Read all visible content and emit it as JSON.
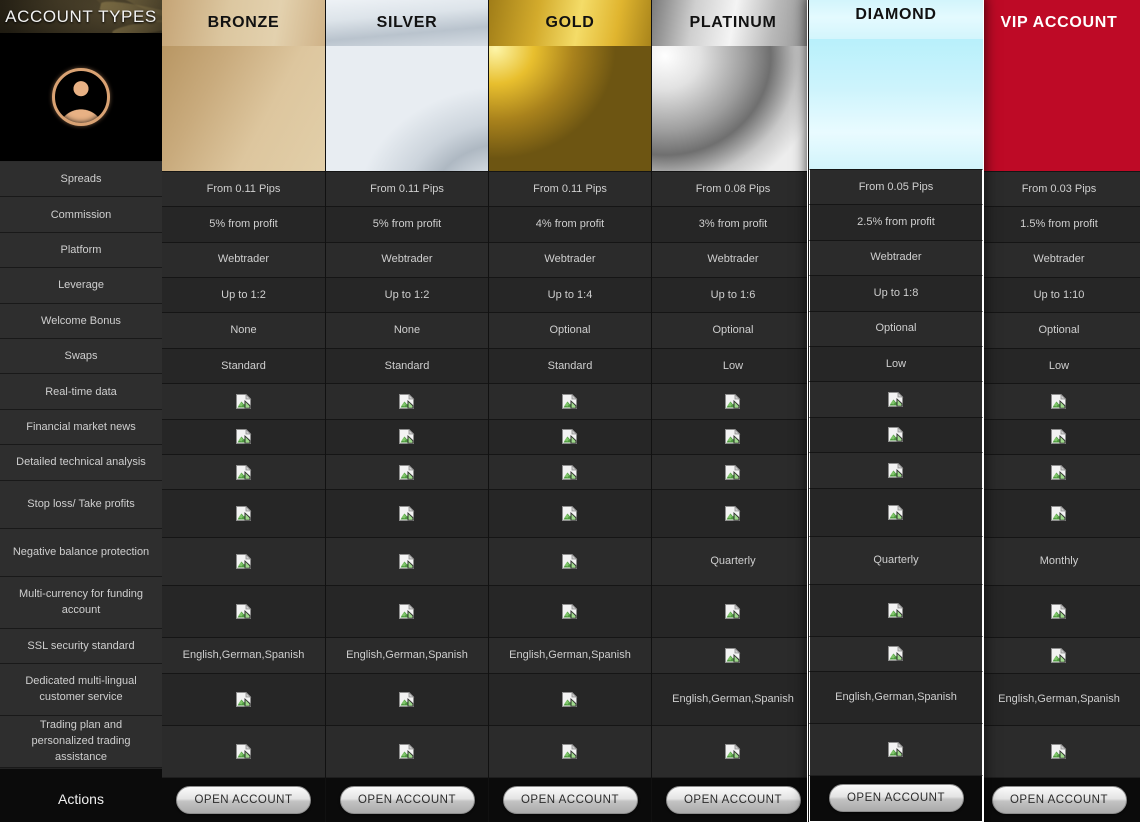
{
  "sidebar": {
    "title": "ACCOUNT TYPES",
    "avatar_icon": "user-avatar-icon",
    "features": [
      {
        "label": "Spreads",
        "size": "one"
      },
      {
        "label": "Commission",
        "size": "one"
      },
      {
        "label": "Platform",
        "size": "one"
      },
      {
        "label": "Leverage",
        "size": "one"
      },
      {
        "label": "Welcome Bonus",
        "size": "one"
      },
      {
        "label": "Swaps",
        "size": "one"
      },
      {
        "label": "Real-time data",
        "size": "one"
      },
      {
        "label": "Financial market news",
        "size": "one"
      },
      {
        "label": "Detailed technical analysis",
        "size": "one"
      },
      {
        "label": "Stop loss/ Take profits",
        "size": "tall"
      },
      {
        "label": "Negative balance protection",
        "size": "tall"
      },
      {
        "label": "Multi-currency for funding account",
        "size": "two"
      },
      {
        "label": "SSL security standard",
        "size": "one"
      },
      {
        "label": "Dedicated multi-lingual customer service",
        "size": "two"
      },
      {
        "label": "Trading plan and personalized trading assistance",
        "size": "two"
      }
    ],
    "actions_label": "Actions"
  },
  "colors": {
    "vip_accent": "#be0a26",
    "diamond_accent": "#cdf4fc",
    "gold_accent": "#e8bf2e",
    "bronze_accent": "#c9ab7d",
    "silver_accent": "#d4dbe2",
    "platinum_accent": "#cfcfcf",
    "cell_background": "#2b2b2b",
    "panel_background": "#000000"
  },
  "cta_label": "OPEN ACCOUNT",
  "broken_image_icon": "broken-image-icon",
  "columns": [
    {
      "name": "BRONZE",
      "head_class": "hd-bronze",
      "swatch_class": "sw-bronze",
      "light_text": false,
      "featured": false,
      "values": [
        "From 0.11 Pips",
        "5% from profit",
        "Webtrader",
        "Up to 1:2",
        "None",
        "Standard",
        "",
        "",
        "",
        "",
        "",
        "",
        "English,German,Spanish",
        ""
      ]
    },
    {
      "name": "SILVER",
      "head_class": "hd-silver",
      "swatch_class": "sw-silver",
      "light_text": false,
      "featured": false,
      "values": [
        "From 0.11 Pips",
        "5% from profit",
        "Webtrader",
        "Up to 1:2",
        "None",
        "Standard",
        "",
        "",
        "",
        "",
        "",
        "",
        "English,German,Spanish",
        ""
      ]
    },
    {
      "name": "GOLD",
      "head_class": "hd-gold",
      "swatch_class": "sw-gold",
      "light_text": false,
      "featured": false,
      "values": [
        "From 0.11 Pips",
        "4% from profit",
        "Webtrader",
        "Up to 1:4",
        "Optional",
        "Standard",
        "",
        "",
        "",
        "",
        "",
        "",
        "English,German,Spanish",
        ""
      ]
    },
    {
      "name": "PLATINUM",
      "head_class": "hd-platinum",
      "swatch_class": "sw-platinum",
      "light_text": false,
      "featured": false,
      "values": [
        "From 0.08 Pips",
        "3% from profit",
        "Webtrader",
        "Up to 1:6",
        "Optional",
        "Low",
        "",
        "",
        "",
        "",
        "Quarterly",
        "",
        "",
        "English,German,Spanish",
        ""
      ]
    },
    {
      "name": "DIAMOND",
      "head_class": "hd-diamond",
      "swatch_class": "sw-diamond",
      "light_text": false,
      "featured": true,
      "values": [
        "From 0.05 Pips",
        "2.5% from profit",
        "Webtrader",
        "Up to 1:8",
        "Optional",
        "Low",
        "",
        "",
        "",
        "",
        "Quarterly",
        "",
        "",
        "English,German,Spanish",
        ""
      ]
    },
    {
      "name": "VIP ACCOUNT",
      "head_class": "hd-vip",
      "swatch_class": "sw-vip",
      "light_text": true,
      "featured": false,
      "values": [
        "From 0.03 Pips",
        "1.5% from profit",
        "Webtrader",
        "Up to 1:10",
        "Optional",
        "Low",
        "",
        "",
        "",
        "",
        "Monthly",
        "",
        "",
        "English,German,Spanish",
        ""
      ]
    }
  ],
  "row_sizes": [
    "one",
    "one",
    "one",
    "one",
    "one",
    "one",
    "one",
    "one",
    "one",
    "tall",
    "tall",
    "two",
    "one",
    "two",
    "two"
  ]
}
